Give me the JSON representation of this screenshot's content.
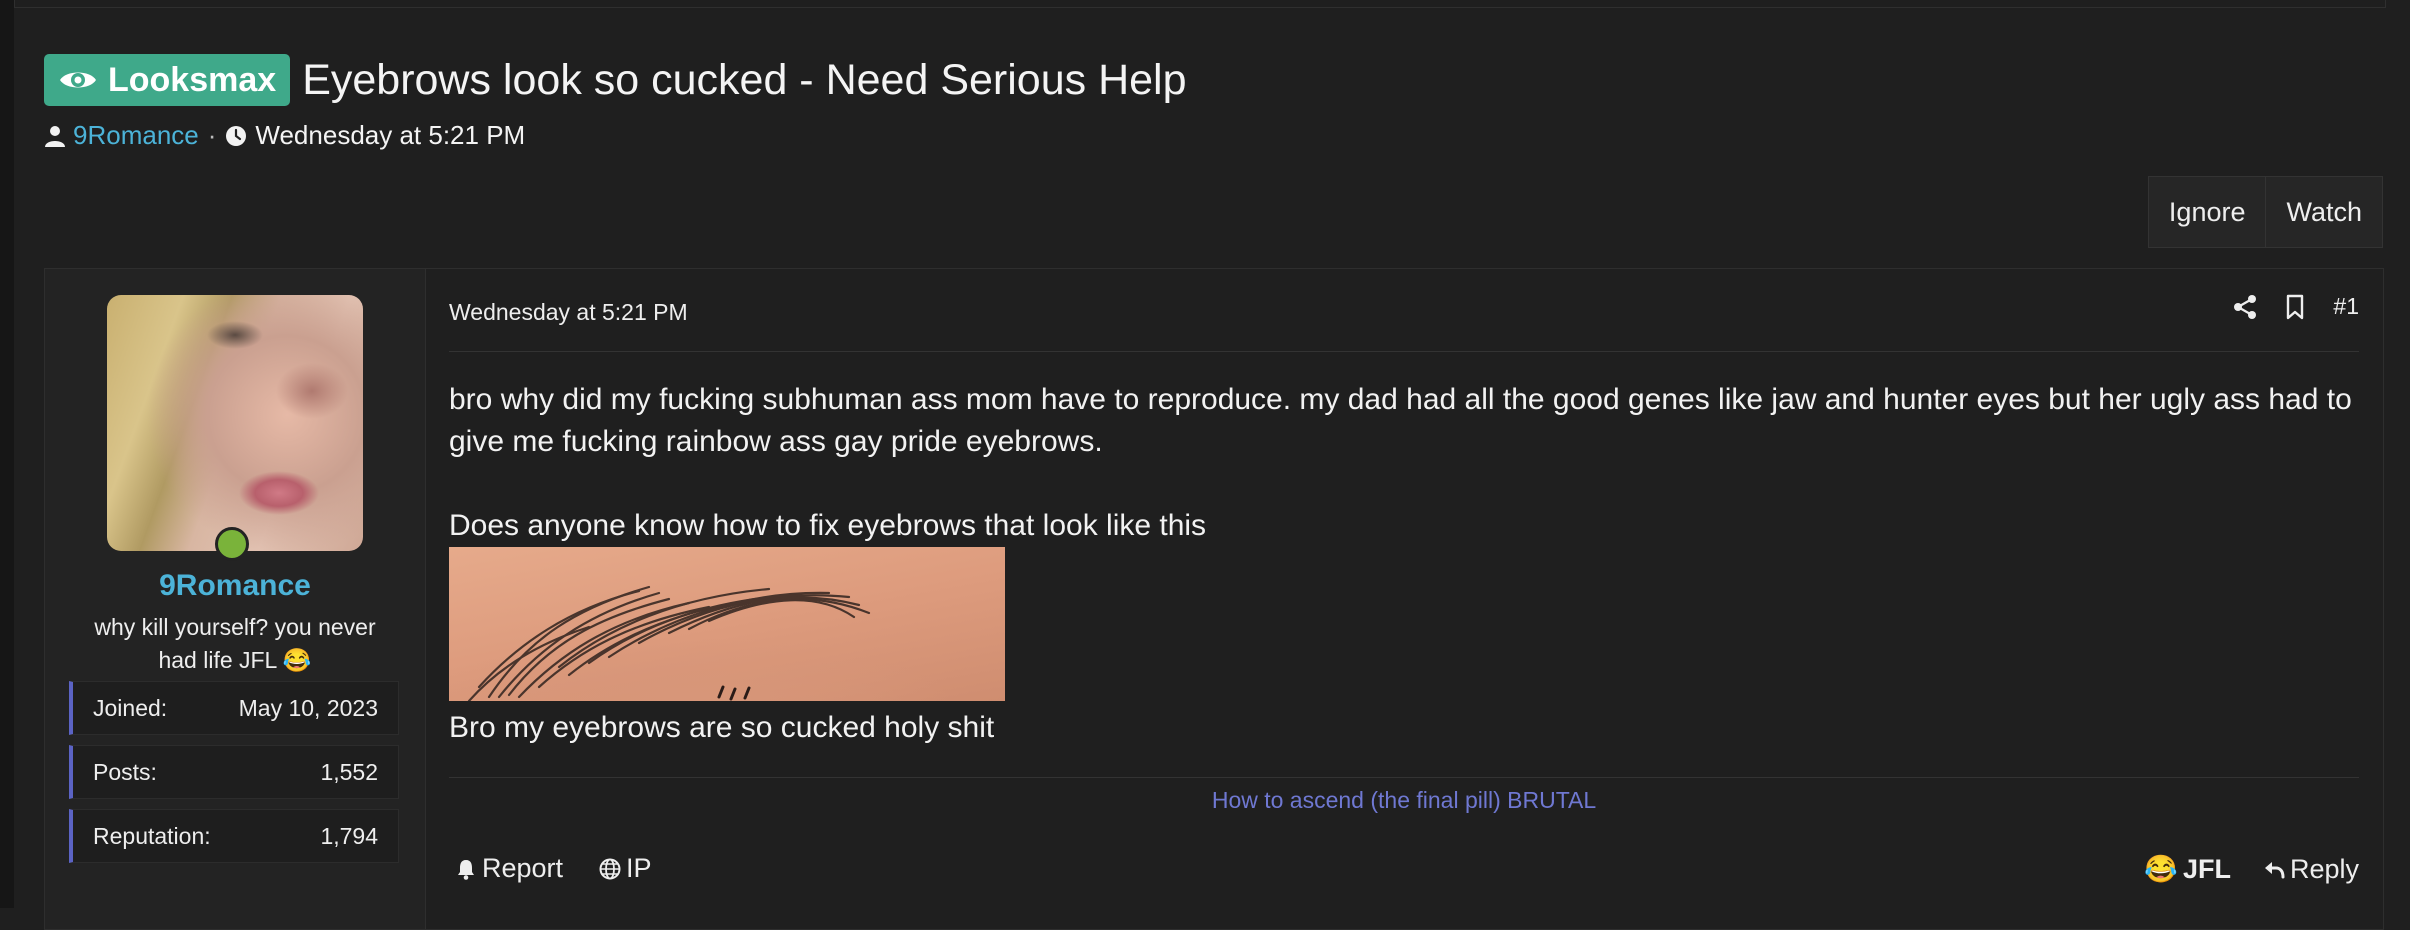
{
  "thread": {
    "prefix": "Looksmax",
    "title": "Eyebrows look so cucked - Need Serious Help",
    "author": "9Romance",
    "separator": "·",
    "date": "Wednesday at 5:21 PM"
  },
  "thread_actions": {
    "ignore": "Ignore",
    "watch": "Watch"
  },
  "user": {
    "name": "9Romance",
    "title": "why kill yourself? you never had life JFL 😂",
    "online": true,
    "stats": [
      {
        "label": "Joined:",
        "value": "May 10, 2023"
      },
      {
        "label": "Posts:",
        "value": "1,552"
      },
      {
        "label": "Reputation:",
        "value": "1,794"
      }
    ]
  },
  "post": {
    "date": "Wednesday at 5:21 PM",
    "number": "#1",
    "text1": "bro why did my fucking subhuman ass mom have to reproduce. my dad had all the good genes like jaw and hunter eyes but her ugly ass had to give me fucking rainbow ass gay pride eyebrows.",
    "text2": "Does anyone know how to fix eyebrows that look like this",
    "text3": "Bro my eyebrows are so cucked holy shit",
    "signature": "How to ascend (the final pill) BRUTAL"
  },
  "footer": {
    "report": "Report",
    "ip": "IP",
    "reaction": "JFL",
    "reaction_emoji": "😂",
    "reply": "Reply"
  },
  "colors": {
    "prefix_bg": "#3fa98a",
    "username": "#4cb3d8",
    "signature_link": "#6f78d2",
    "stat_accent": "#5b63c4",
    "online": "#7ab33a"
  }
}
